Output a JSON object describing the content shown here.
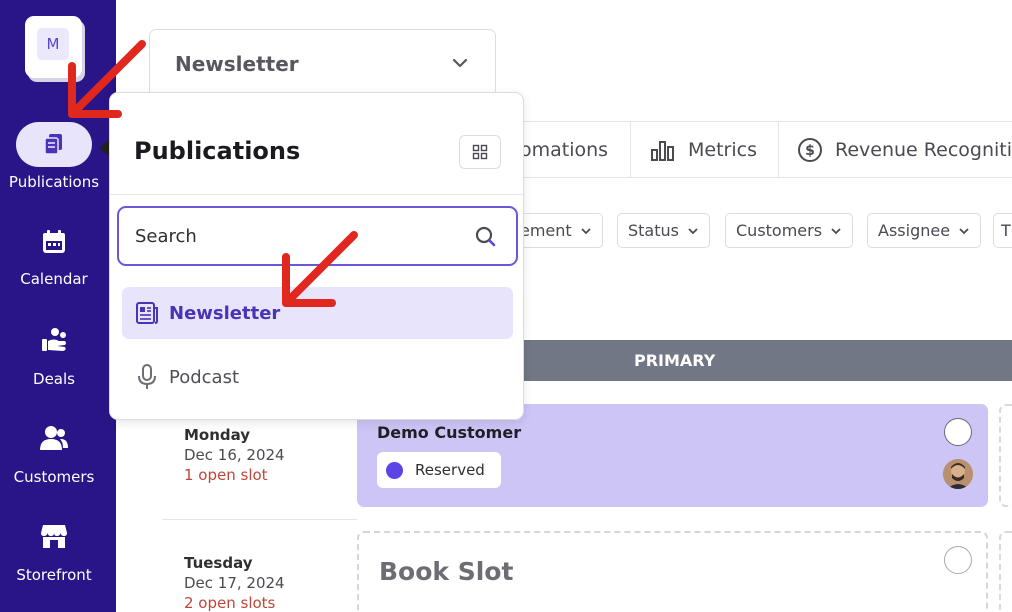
{
  "sidebar": {
    "logo_letter": "M",
    "items": [
      {
        "label": "Publications",
        "icon": "publications-icon",
        "active": true
      },
      {
        "label": "Calendar",
        "icon": "calendar-icon"
      },
      {
        "label": "Deals",
        "icon": "deals-icon"
      },
      {
        "label": "Customers",
        "icon": "customers-icon"
      },
      {
        "label": "Storefront",
        "icon": "storefront-icon"
      }
    ]
  },
  "publication_select": {
    "value": "Newsletter"
  },
  "tabs": [
    {
      "label": "omations",
      "icon": null
    },
    {
      "label": "Metrics",
      "icon": "bar-chart-icon"
    },
    {
      "label": "Revenue Recogniti",
      "icon": "dollar-circle-icon"
    }
  ],
  "filters": [
    {
      "label": "ement"
    },
    {
      "label": "Status"
    },
    {
      "label": "Customers"
    },
    {
      "label": "Assignee"
    },
    {
      "label": "T"
    }
  ],
  "schedule": {
    "column_header": "PRIMARY",
    "rows": [
      {
        "day": "Monday",
        "date": "Dec 16, 2024",
        "slots": "1 open slot",
        "card": {
          "customer": "Demo Customer",
          "status": "Reserved"
        }
      },
      {
        "day": "Tuesday",
        "date": "Dec 17, 2024",
        "slots": "2 open slots",
        "card": {
          "label": "Book Slot"
        }
      }
    ]
  },
  "popover": {
    "title": "Publications",
    "search_value": "Search",
    "options": [
      {
        "label": "Newsletter",
        "icon": "newspaper-icon",
        "selected": true
      },
      {
        "label": "Podcast",
        "icon": "microphone-icon",
        "selected": false
      }
    ]
  },
  "colors": {
    "sidebar_bg": "#2a1588",
    "accent": "#5b45e6",
    "reserved_card": "#cdc5f6",
    "annotation_arrow": "#e0281f"
  }
}
